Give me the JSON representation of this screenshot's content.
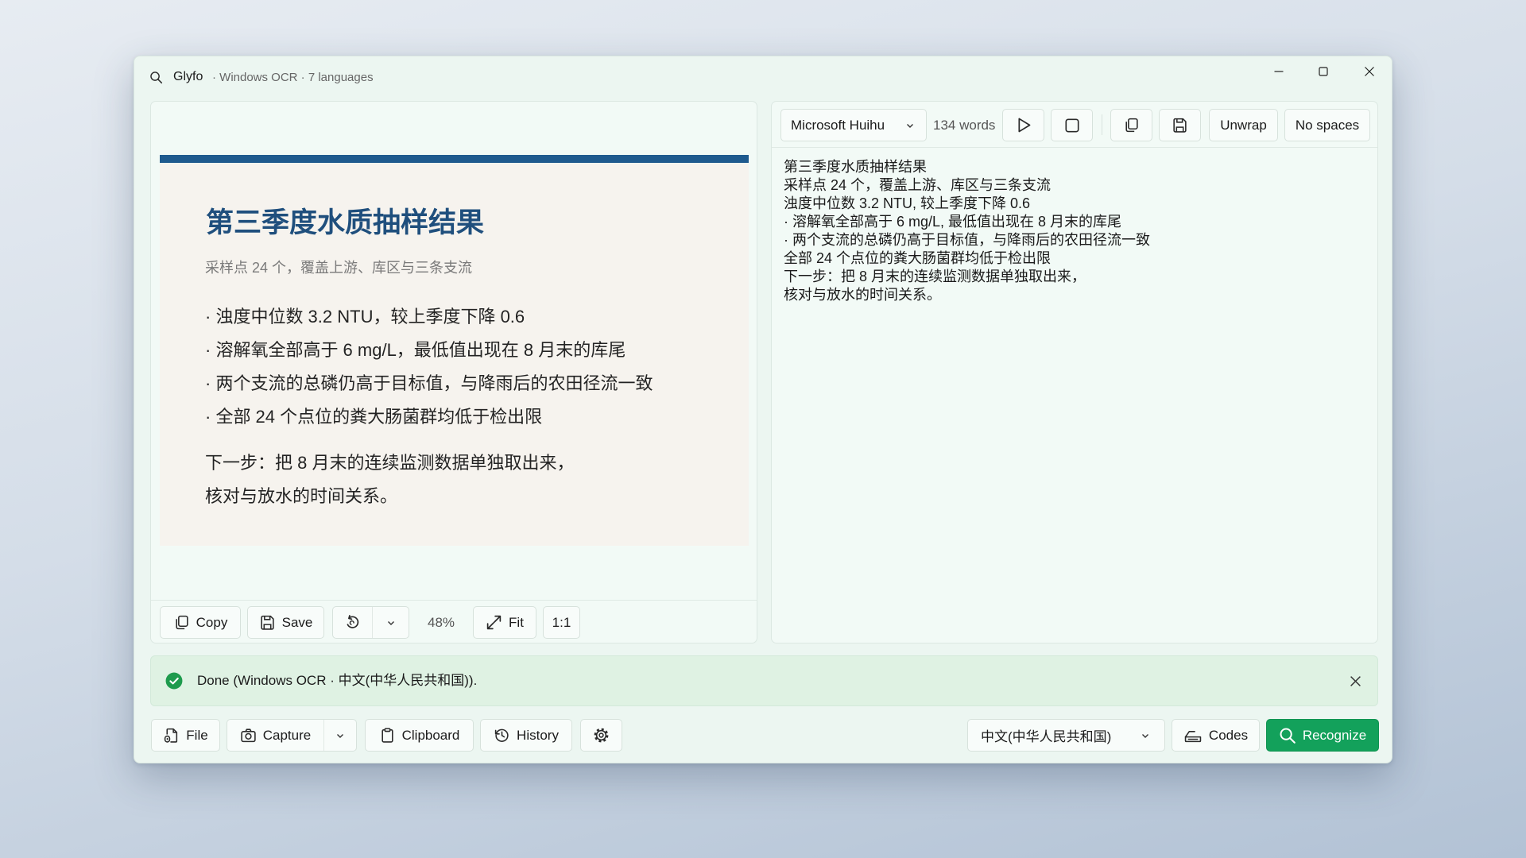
{
  "window": {
    "app_name": "Glyfo",
    "subtitle": "· Windows OCR · 7 languages",
    "app_icon": "search-icon",
    "controls": [
      "minimize-icon",
      "maximize-icon",
      "close-icon"
    ]
  },
  "preview": {
    "title": "第三季度水质抽样结果",
    "subtitle": "采样点 24 个，覆盖上游、库区与三条支流",
    "bullets": [
      "· 浊度中位数 3.2 NTU，较上季度下降 0.6",
      "· 溶解氧全部高于 6 mg/L，最低值出现在 8 月末的库尾",
      "· 两个支流的总磷仍高于目标值，与降雨后的农田径流一致",
      "· 全部 24 个点位的粪大肠菌群均低于检出限"
    ],
    "next_steps": [
      "下一步：把 8 月末的连续监测数据单独取出来，",
      "核对与放水的时间关系。"
    ]
  },
  "preview_toolbar": {
    "copy_label": "Copy",
    "save_label": "Save",
    "zoom": "48%",
    "fit_label": "Fit",
    "actual_size_label": "1:1",
    "icons": [
      "copy-icon",
      "save-icon",
      "rotate-icon",
      "chevron-down-icon",
      "fit-icon"
    ]
  },
  "text_toolbar": {
    "font_value": "Microsoft Huihu",
    "word_count": "134 words",
    "unwrap_label": "Unwrap",
    "no_spaces_label": "No spaces",
    "icons": [
      "chevron-down-icon",
      "play-icon",
      "stop-icon",
      "copy-icon",
      "save-icon"
    ]
  },
  "ocr_text": {
    "lines": [
      "第三季度水质抽样结果",
      "采样点 24 个，覆盖上游、库区与三条支流",
      "浊度中位数 3.2 NTU, 较上季度下降 0.6",
      "· 溶解氧全部高于 6 mg/L, 最低值出现在 8 月末的库尾",
      "· 两个支流的总磷仍高于目标值，与降雨后的农田径流一致",
      "全部 24 个点位的粪大肠菌群均低于检出限",
      "下一步：把 8 月末的连续监测数据单独取出来，",
      "核对与放水的时间关系。"
    ]
  },
  "status": {
    "state": "success",
    "message": "Done (Windows OCR · 中文(中华人民共和国)).",
    "icon": "check-circle-icon"
  },
  "bottom_toolbar": {
    "file_label": "File",
    "capture_label": "Capture",
    "clipboard_label": "Clipboard",
    "history_label": "History",
    "language": "中文(中华人民共和国)",
    "codes_label": "Codes",
    "recognize_label": "Recognize",
    "icons": [
      "file-icon",
      "camera-icon",
      "chevron-down-icon",
      "clipboard-icon",
      "history-icon",
      "gear-icon",
      "scanner-icon",
      "search-icon"
    ]
  },
  "colors": {
    "accent": "#13a15b",
    "success": "#1e9b4d",
    "status_background": "#dff2e3",
    "preview_heading": "#1f4f7d",
    "preview_rule": "#1e5a8e",
    "window_background": "#ecf6f1"
  }
}
